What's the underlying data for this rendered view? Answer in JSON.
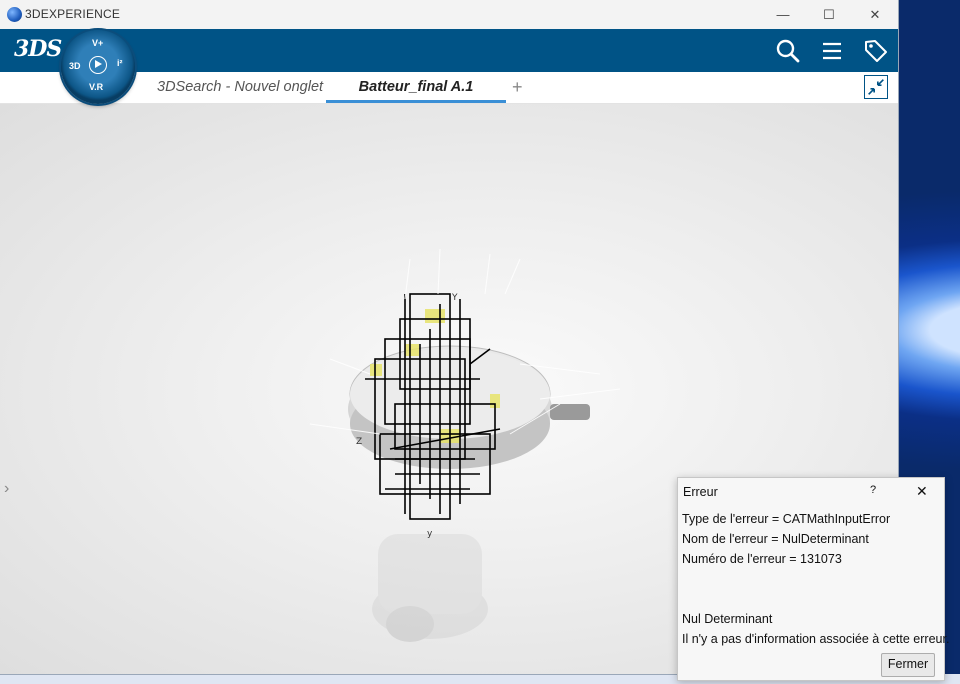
{
  "window": {
    "title": "3DEXPERIENCE",
    "controls": {
      "minimize": "—",
      "maximize": "☐",
      "close": "✕"
    }
  },
  "topbar": {
    "brand_logo": "3DS",
    "compass": {
      "north": "V+",
      "west": "3D",
      "east": "i²",
      "south": "V.R"
    },
    "icons": [
      "search-icon",
      "menu-icon",
      "tag-icon"
    ],
    "background": "#005386"
  },
  "tabs": [
    {
      "label": "3DSearch - Nouvel onglet",
      "active": false
    },
    {
      "label": "Batteur_final A.1",
      "active": true
    }
  ],
  "tab_add": "+",
  "side_toggle": "›",
  "dialog": {
    "title": "Erreur",
    "help": "?",
    "close": "✕",
    "lines": [
      "Type de l'erreur = CATMathInputError",
      "Nom de l'erreur = NulDeterminant",
      "Numéro de l'erreur = 131073"
    ],
    "message_title": "Nul Determinant",
    "message_body": "Il n'y a pas d'information associée à cette erreur.",
    "button": "Fermer"
  }
}
